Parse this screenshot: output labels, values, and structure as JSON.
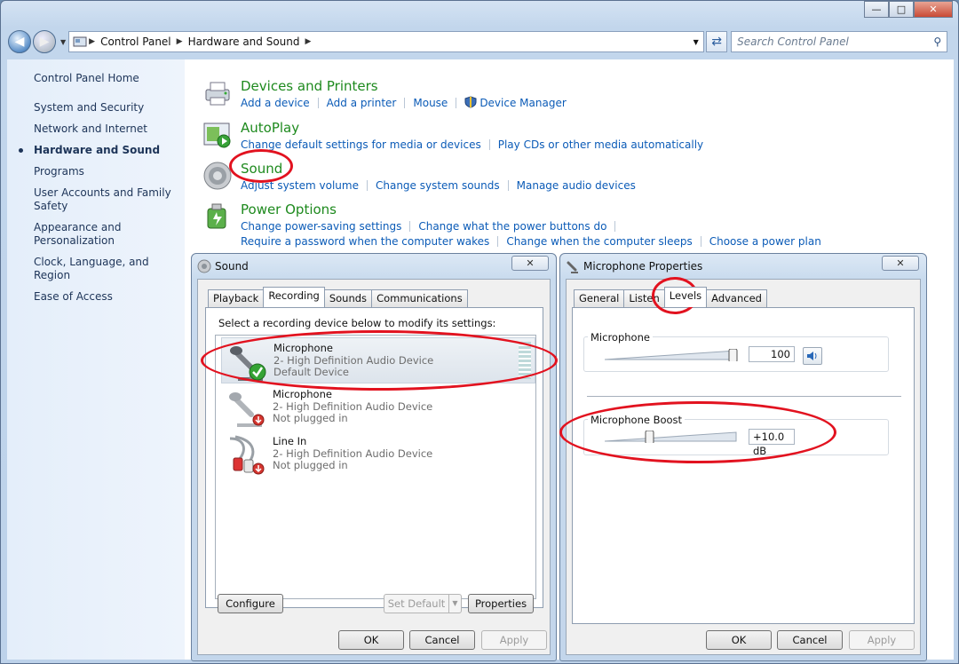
{
  "window": {
    "caption_min": "—",
    "caption_max": "□",
    "caption_close": "✕"
  },
  "address": {
    "crumbs": [
      "Control Panel",
      "Hardware and Sound"
    ],
    "search_placeholder": "Search Control Panel"
  },
  "sidebar": {
    "home": "Control Panel Home",
    "items": [
      "System and Security",
      "Network and Internet",
      "Hardware and Sound",
      "Programs",
      "User Accounts and Family Safety",
      "Appearance and Personalization",
      "Clock, Language, and Region",
      "Ease of Access"
    ]
  },
  "categories": {
    "devices": {
      "title": "Devices and Printers",
      "links": [
        "Add a device",
        "Add a printer",
        "Mouse",
        "Device Manager"
      ]
    },
    "autoplay": {
      "title": "AutoPlay",
      "links": [
        "Change default settings for media or devices",
        "Play CDs or other media automatically"
      ]
    },
    "sound": {
      "title": "Sound",
      "links": [
        "Adjust system volume",
        "Change system sounds",
        "Manage audio devices"
      ]
    },
    "power": {
      "title": "Power Options",
      "links": [
        "Change power-saving settings",
        "Change what the power buttons do",
        "Require a password when the computer wakes",
        "Change when the computer sleeps",
        "Choose a power plan"
      ]
    }
  },
  "sound_dialog": {
    "title": "Sound",
    "tabs": [
      "Playback",
      "Recording",
      "Sounds",
      "Communications"
    ],
    "instruction": "Select a recording device below to modify its settings:",
    "devices": [
      {
        "name": "Microphone",
        "desc": "2- High Definition Audio Device",
        "status": "Default Device"
      },
      {
        "name": "Microphone",
        "desc": "2- High Definition Audio Device",
        "status": "Not plugged in"
      },
      {
        "name": "Line In",
        "desc": "2- High Definition Audio Device",
        "status": "Not plugged in"
      }
    ],
    "configure": "Configure",
    "set_default": "Set Default",
    "properties": "Properties",
    "ok": "OK",
    "cancel": "Cancel",
    "apply": "Apply"
  },
  "mic_dialog": {
    "title": "Microphone Properties",
    "tabs": [
      "General",
      "Listen",
      "Levels",
      "Advanced"
    ],
    "microphone_label": "Microphone",
    "microphone_value": "100",
    "microphone_level": 1.0,
    "boost_label": "Microphone Boost",
    "boost_value": "+10.0 dB",
    "boost_level": 0.33,
    "ok": "OK",
    "cancel": "Cancel",
    "apply": "Apply"
  },
  "colors": {
    "annotation": "#e2121f",
    "link": "#0b5bb7",
    "category_title": "#1e8a1e"
  }
}
